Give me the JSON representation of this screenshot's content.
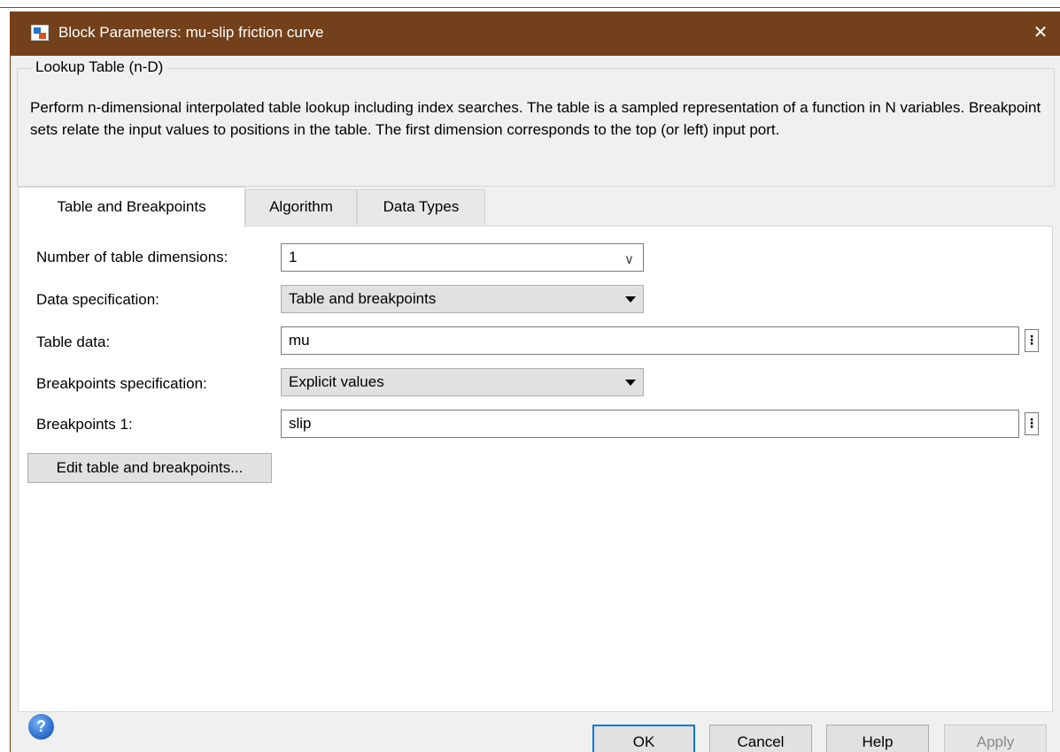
{
  "window": {
    "title": "Block Parameters: mu-slip friction curve",
    "close_glyph": "✕"
  },
  "block": {
    "group_title": "Lookup Table (n-D)",
    "description": "Perform n-dimensional interpolated table lookup including index searches. The table is a sampled representation of a function in N variables. Breakpoint sets relate the input values to positions in the table. The first dimension corresponds to the top (or left) input port."
  },
  "tabs": [
    {
      "label": "Table and Breakpoints",
      "active": true
    },
    {
      "label": "Algorithm",
      "active": false
    },
    {
      "label": "Data Types",
      "active": false
    }
  ],
  "fields": {
    "num_dims": {
      "label": "Number of table dimensions:",
      "value": "1"
    },
    "data_spec": {
      "label": "Data specification:",
      "value": "Table and breakpoints"
    },
    "table_data": {
      "label": "Table data:",
      "value": "mu"
    },
    "bp_spec": {
      "label": "Breakpoints specification:",
      "value": "Explicit values"
    },
    "bp1": {
      "label": "Breakpoints 1:",
      "value": "slip"
    }
  },
  "edit_button": "Edit table and breakpoints...",
  "buttons": {
    "ok": "OK",
    "cancel": "Cancel",
    "help": "Help",
    "apply": "Apply"
  },
  "icons": {
    "help_glyph": "?",
    "more_glyph": "⋮",
    "chevron_glyph": "∨"
  },
  "colors": {
    "titlebar": "#72401a",
    "dialog_bg": "#f0f0f0",
    "default_button_border": "#0078d7"
  }
}
